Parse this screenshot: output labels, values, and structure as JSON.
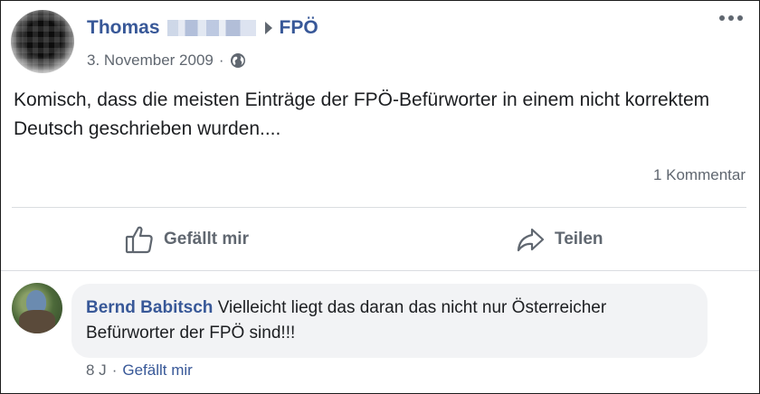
{
  "post": {
    "author_first_name": "Thomas",
    "group_name": "FPÖ",
    "date": "3. November 2009",
    "meta_separator": "·",
    "privacy_icon": "globe-icon",
    "text": "Komisch, dass die meisten Einträge der FPÖ-Befürworter in einem nicht korrektem Deutsch geschrieben wurden....",
    "comment_count": "1 Kommentar"
  },
  "actions": {
    "like_label": "Gefällt mir",
    "like_icon": "thumbs-up-icon",
    "share_label": "Teilen",
    "share_icon": "share-arrow-icon"
  },
  "comment": {
    "author": "Bernd Babitsch",
    "text": "Vielleicht liegt das daran das nicht nur Österreicher Befürworter der FPÖ sind!!!",
    "age": "8 J",
    "separator": "·",
    "like_label": "Gefällt mir"
  },
  "colors": {
    "link_blue": "#385898",
    "secondary_text": "#606770",
    "bubble_bg": "#f2f3f5",
    "divider": "#dadde1"
  }
}
